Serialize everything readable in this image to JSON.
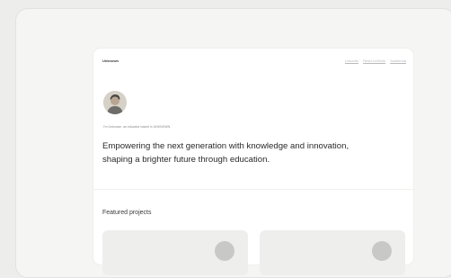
{
  "site": {
    "name": "Unknown"
  },
  "nav": {
    "items": [
      {
        "label": "LinkedIn"
      },
      {
        "label": "Read.cv/Work"
      },
      {
        "label": "Academia"
      }
    ]
  },
  "profile": {
    "tagline": "I'm Unknown, an educator based in UNKNOWN.",
    "headline": "Empowering the next generation with knowledge and innovation, shaping a brighter future through education."
  },
  "featured": {
    "title": "Featured projects"
  },
  "colors": {
    "background": "#ededec",
    "card": "#ffffff",
    "project_card": "#eeeeed"
  }
}
